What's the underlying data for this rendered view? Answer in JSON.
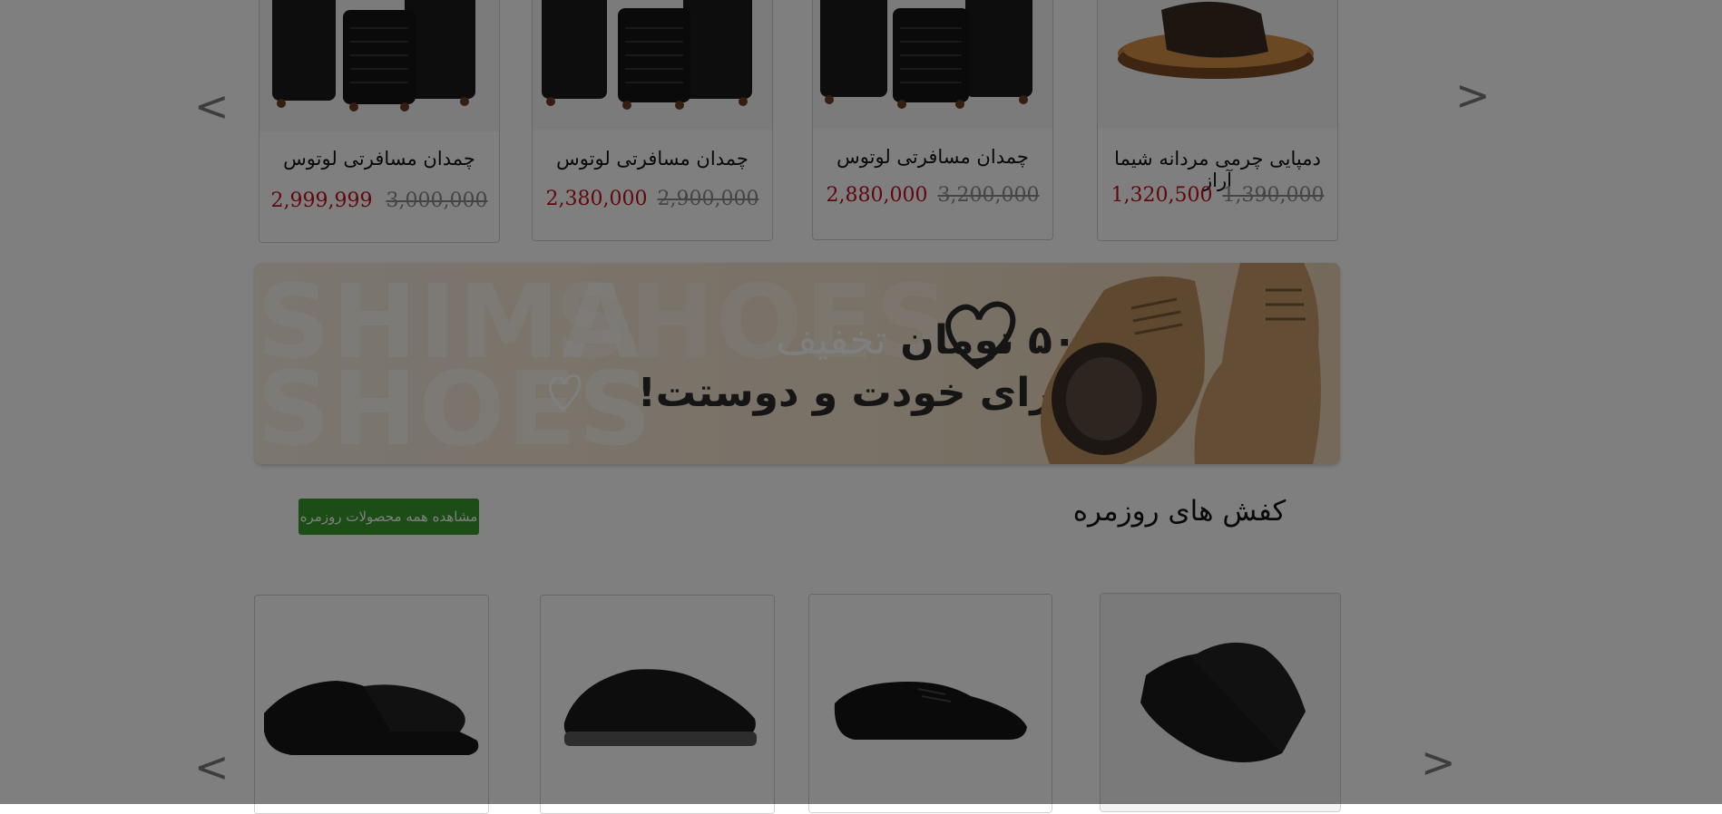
{
  "carousel_top": {
    "prev_label": "<",
    "next_label": ">",
    "products": [
      {
        "title": "چمدان مسافرتی لوتوس",
        "price": "2,999,999",
        "old_price": "3,000,000",
        "image": "luggage-set"
      },
      {
        "title": "چمدان مسافرتی لوتوس",
        "price": "2,380,000",
        "old_price": "2,900,000",
        "image": "luggage-set"
      },
      {
        "title": "چمدان مسافرتی لوتوس",
        "price": "2,880,000",
        "old_price": "3,200,000",
        "image": "luggage-set"
      },
      {
        "title": "دمپایی چرمی مردانه شیما آراز",
        "price": "1,320,500",
        "old_price": "1,390,000",
        "image": "leather-slide-sandal"
      }
    ]
  },
  "banner": {
    "bg_word_1": "SHIMA",
    "bg_word_2": "SHOES",
    "bg_word_3": "SHOES",
    "amount": "۵۰ تومان",
    "discount_word": "تخفیف",
    "line2": "برای خودت و دوستت!"
  },
  "daily_section": {
    "title": "کفش های روزمره",
    "view_all_label": "مشاهده همه محصولات روزمره",
    "prev_label": "<",
    "next_label": ">",
    "products": [
      {
        "image": "black-derby-shoe"
      },
      {
        "image": "black-slip-on-sneaker"
      },
      {
        "image": "black-leather-lace-up-shoe"
      },
      {
        "image": "black-leather-sneaker"
      }
    ]
  },
  "colors": {
    "price_new": "#c0101a",
    "price_old": "#8a8a8a",
    "button_green": "#3a9a2c",
    "overlay": "rgba(0,0,0,0.5)"
  }
}
